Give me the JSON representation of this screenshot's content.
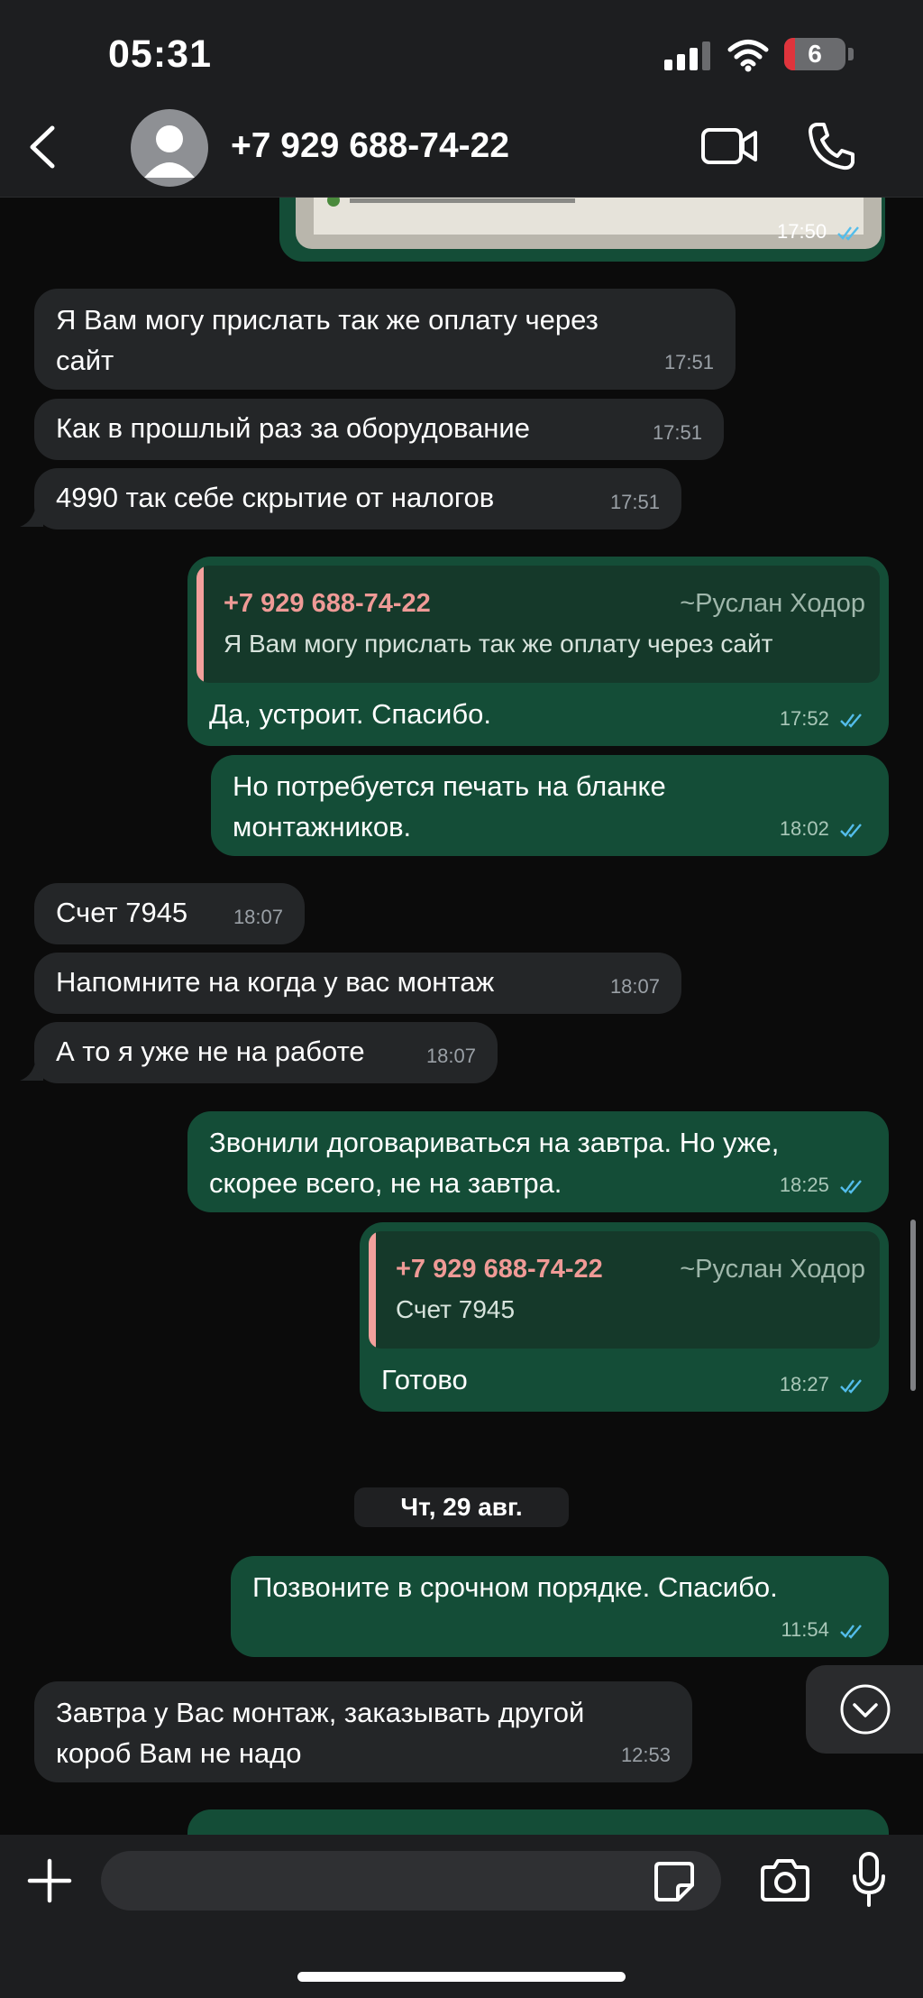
{
  "status_bar": {
    "time": "05:31",
    "battery": "6"
  },
  "header": {
    "contact": "+7 929 688-74-22"
  },
  "messages": {
    "img_time": "17:50",
    "m1": {
      "l1": "Я Вам могу прислать так же оплату через",
      "l2": "сайт",
      "time": "17:51"
    },
    "m2": {
      "text": "Как в прошлый раз за оборудование",
      "time": "17:51"
    },
    "m3": {
      "text": "4990 так себе скрытие от налогов",
      "time": "17:51"
    },
    "m4": {
      "quote_name": "+7 929 688-74-22",
      "quote_alias": "~Руслан Ходор",
      "quote_text": "Я Вам могу прислать так же оплату через сайт",
      "text": "Да, устроит. Спасибо.",
      "time": "17:52"
    },
    "m5": {
      "l1": "Но потребуется печать на бланке",
      "l2": "монтажников.",
      "time": "18:02"
    },
    "m6": {
      "text": "Счет 7945",
      "time": "18:07"
    },
    "m7": {
      "text": "Напомните на когда у вас монтаж",
      "time": "18:07"
    },
    "m8": {
      "text": "А то я уже не на работе",
      "time": "18:07"
    },
    "m9": {
      "l1": "Звонили договариваться на завтра. Но уже,",
      "l2": "скорее всего, не на завтра.",
      "time": "18:25"
    },
    "m10": {
      "quote_name": "+7 929 688-74-22",
      "quote_alias": "~Руслан Ходор",
      "quote_text": "Счет 7945",
      "text": "Готово",
      "time": "18:27"
    },
    "date_separator": "Чт, 29 авг.",
    "m11": {
      "text": "Позвоните в срочном порядке. Спасибо.",
      "time": "11:54"
    },
    "m12": {
      "l1": "Завтра у Вас монтаж, заказывать другой",
      "l2": "короб Вам не надо",
      "time": "12:53"
    }
  },
  "colors": {
    "incoming": "#242628",
    "outgoing": "#144d37",
    "quote_name": "#ef9a96",
    "ticks": "#53bdeb"
  }
}
